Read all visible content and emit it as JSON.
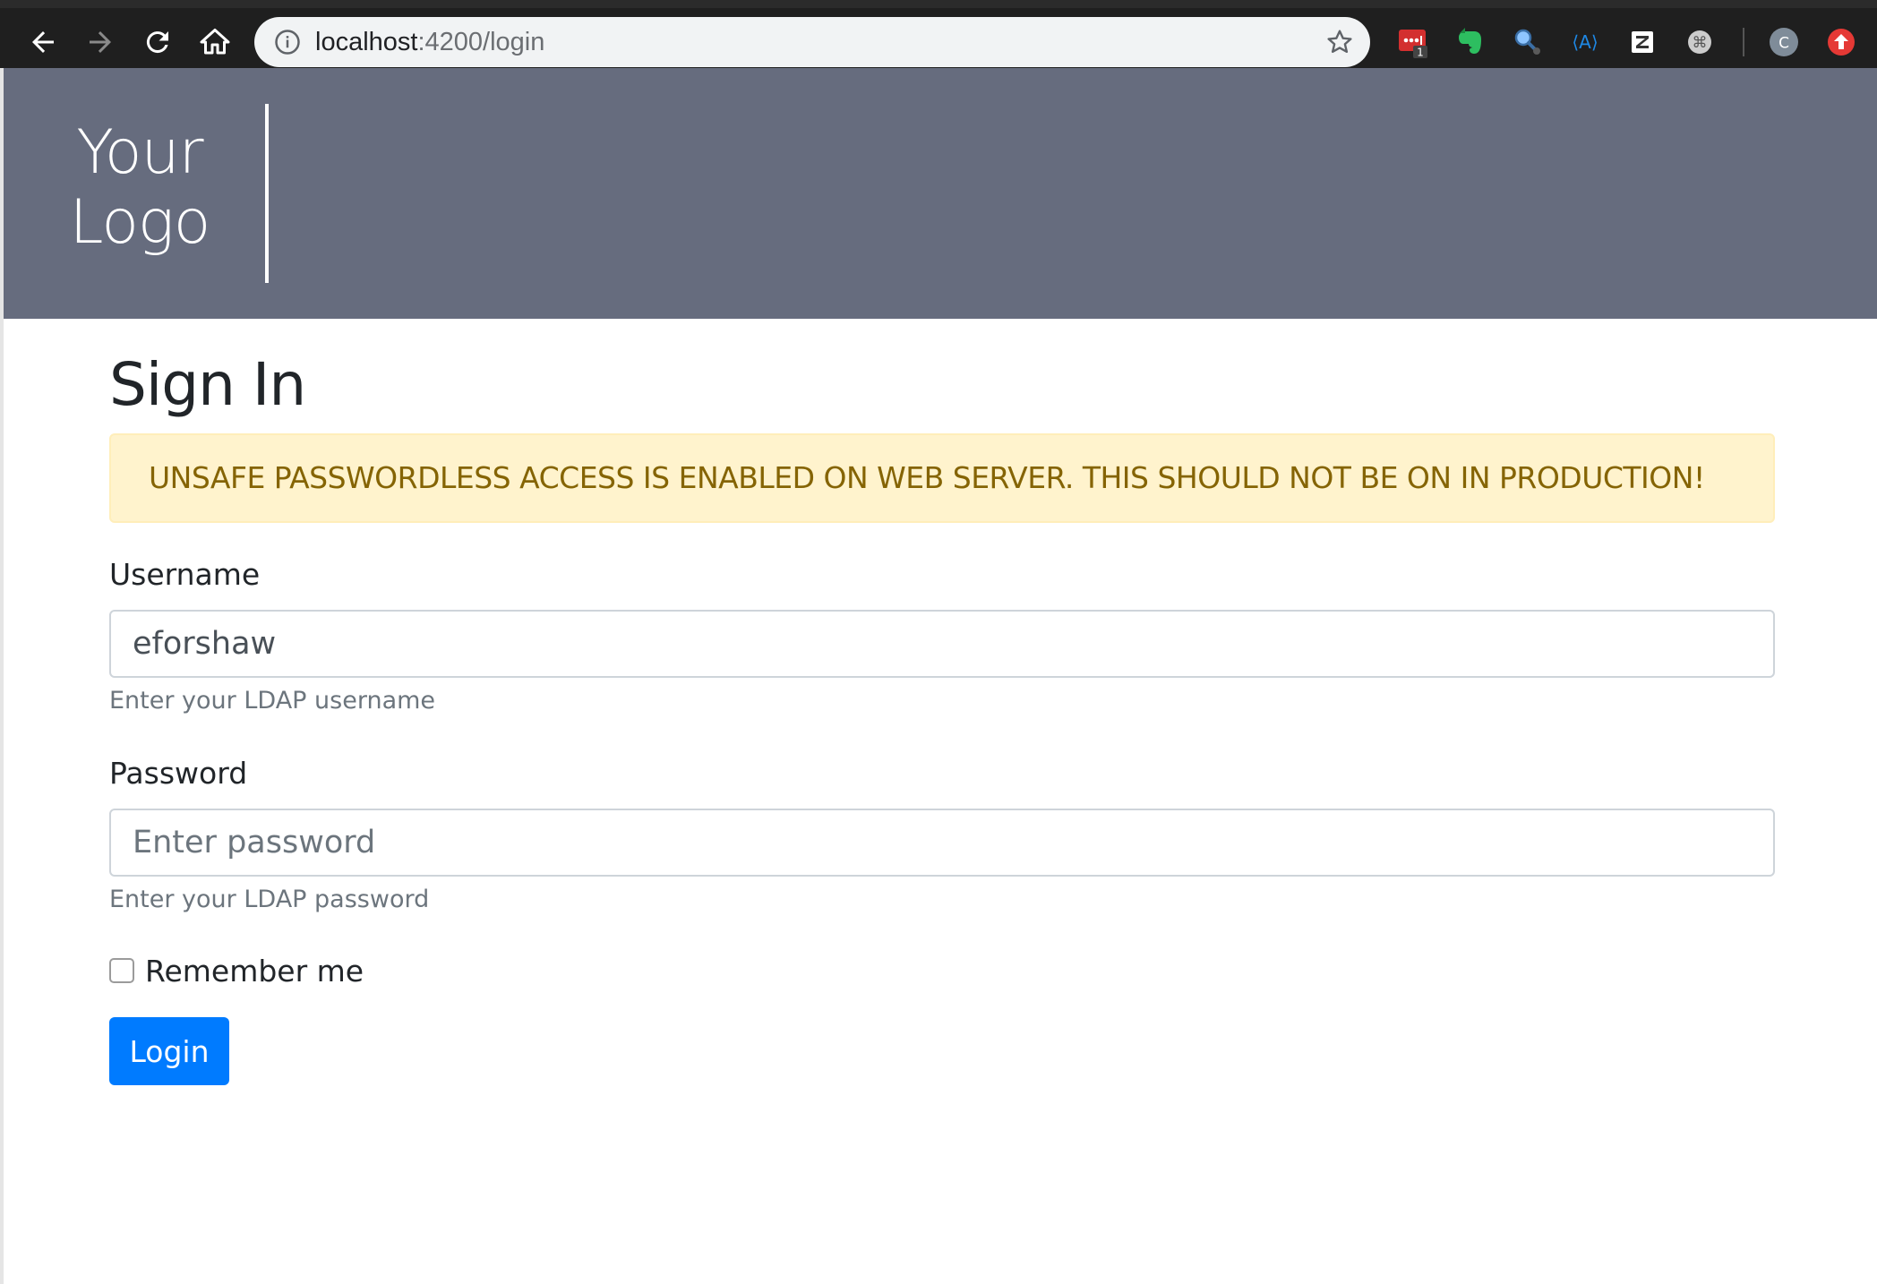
{
  "browser": {
    "url_host": "localhost",
    "url_path": ":4200/login",
    "extensions": [
      {
        "name": "lastpass-icon",
        "badge": "1",
        "color": "#d32f2f"
      },
      {
        "name": "evernote-icon",
        "color": "#2dbe60"
      },
      {
        "name": "magnifier-extension-icon",
        "color": "#4a90d9"
      },
      {
        "name": "angular-extension-icon",
        "color": "#1e88e5"
      },
      {
        "name": "zotero-icon",
        "color": "#ffffff"
      },
      {
        "name": "command-extension-icon",
        "color": "#cccccc"
      }
    ],
    "profile_initial": "C",
    "update_icon_color": "#e53935"
  },
  "header": {
    "logo_line1": "Your",
    "logo_line2": "Logo",
    "background": "#666c7e"
  },
  "main": {
    "title": "Sign In",
    "alert": "UNSAFE PASSWORDLESS ACCESS IS ENABLED ON WEB SERVER. THIS SHOULD NOT BE ON IN PRODUCTION!",
    "username": {
      "label": "Username",
      "value": "eforshaw",
      "help": "Enter your LDAP username"
    },
    "password": {
      "label": "Password",
      "placeholder": "Enter password",
      "help": "Enter your LDAP password"
    },
    "remember_label": "Remember me",
    "login_label": "Login"
  }
}
